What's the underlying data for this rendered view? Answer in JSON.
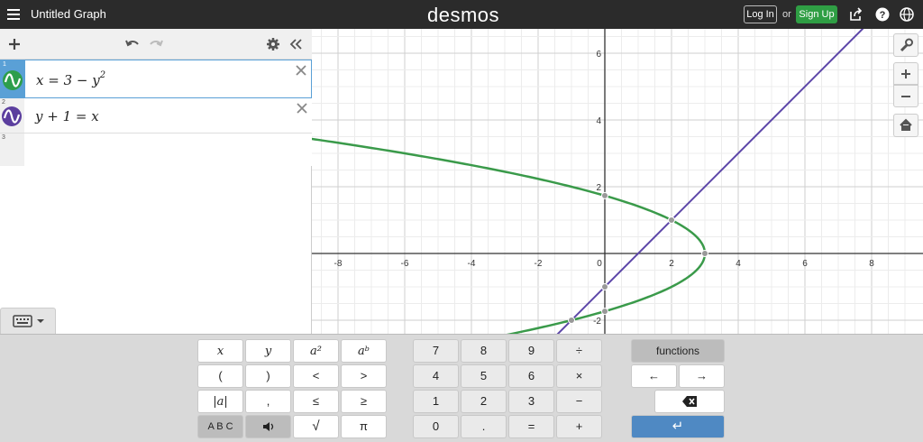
{
  "topbar": {
    "title": "Untitled Graph",
    "brand": "desmos",
    "login_label": "Log In",
    "or_text": "or",
    "signup_label": "Sign Up"
  },
  "expressions": [
    {
      "number": "1",
      "latex_lhs": "x",
      "text_a": "x = 3 − y",
      "sup": "2",
      "color": "#2d9e4b"
    },
    {
      "number": "2",
      "text_a": "y + 1 = x",
      "sup": "",
      "color": "#5b3e9e"
    },
    {
      "number": "3",
      "text_a": "",
      "sup": ""
    }
  ],
  "graph": {
    "x_ticks": [
      "-8",
      "-6",
      "-4",
      "-2",
      "0",
      "2",
      "4",
      "6",
      "8"
    ],
    "y_ticks_pos": [
      "6",
      "4",
      "2"
    ],
    "y_tick_neg": "-2",
    "curve_colors": {
      "parabola": "#3a9a4a",
      "line": "#5c46a8",
      "point": "#999999"
    }
  },
  "chart_data": {
    "type": "line",
    "title": "",
    "xlabel": "",
    "ylabel": "",
    "xlim": [
      -8.6,
      9.2
    ],
    "ylim": [
      -2.3,
      6.7
    ],
    "grid": true,
    "series": [
      {
        "name": "x = 3 − y^2",
        "kind": "parametric",
        "equation": "x = 3 - y^2"
      },
      {
        "name": "y + 1 = x",
        "kind": "line",
        "equation": "y = x - 1"
      }
    ],
    "points": [
      {
        "x": 0,
        "y": 1.732
      },
      {
        "x": 2,
        "y": 1
      },
      {
        "x": 3,
        "y": 0
      },
      {
        "x": 0,
        "y": -1.732
      },
      {
        "x": -1,
        "y": -2
      },
      {
        "x": 0,
        "y": -1
      }
    ]
  },
  "keypad": {
    "row1": [
      "x",
      "y",
      "a²",
      "aᵇ",
      "7",
      "8",
      "9",
      "÷",
      "functions"
    ],
    "row2": [
      "(",
      ")",
      "<",
      ">",
      "4",
      "5",
      "6",
      "×",
      "←",
      "→"
    ],
    "row3": [
      "|a|",
      ",",
      "≤",
      "≥",
      "1",
      "2",
      "3",
      "−",
      "⌫"
    ],
    "row4": [
      "A B C",
      "🔊",
      "√",
      "π",
      "0",
      ".",
      "=",
      "+",
      "↵"
    ]
  }
}
